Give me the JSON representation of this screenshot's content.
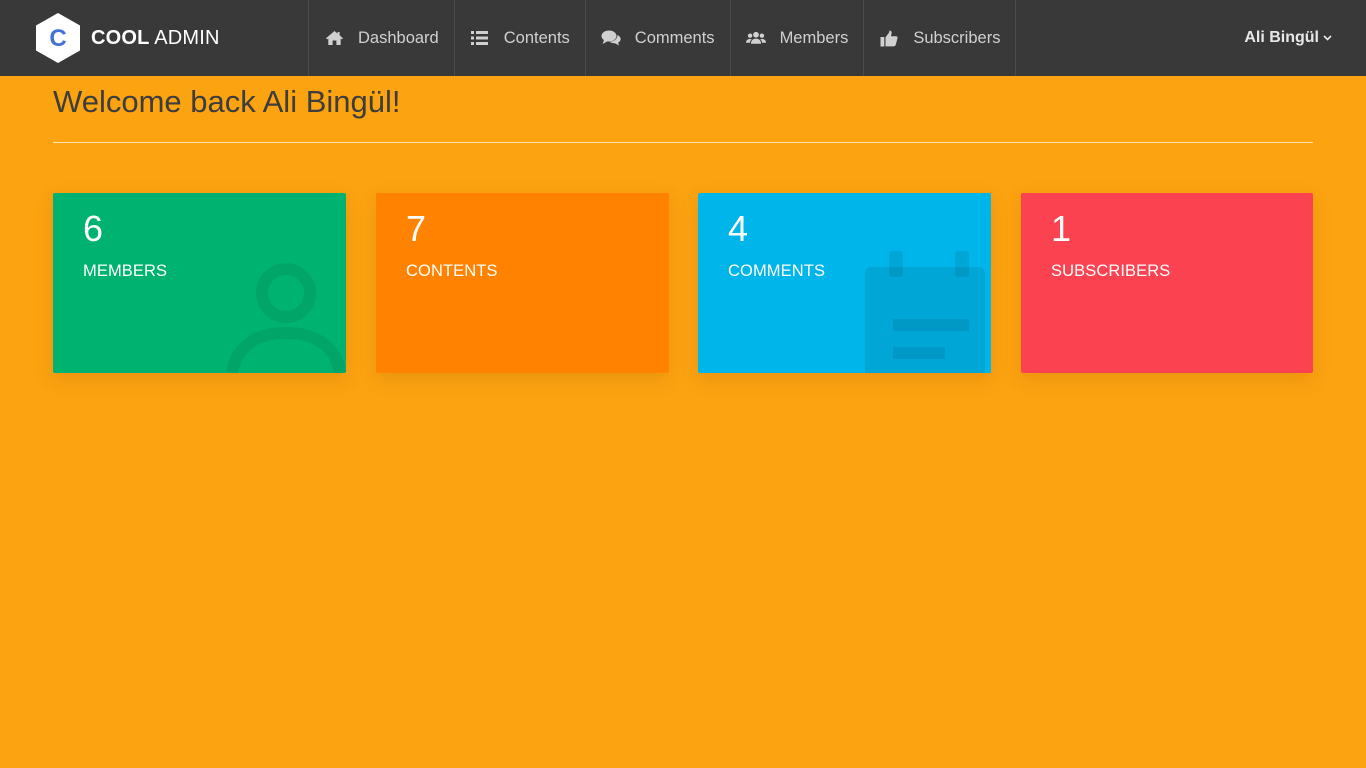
{
  "brand": {
    "logo_letter": "C",
    "name_bold": "COOL",
    "name_light": "ADMIN"
  },
  "nav": {
    "items": [
      {
        "label": "Dashboard",
        "icon": "home-icon"
      },
      {
        "label": "Contents",
        "icon": "list-icon"
      },
      {
        "label": "Comments",
        "icon": "comments-icon"
      },
      {
        "label": "Members",
        "icon": "users-icon"
      },
      {
        "label": "Subscribers",
        "icon": "thumbs-up-icon"
      }
    ]
  },
  "user": {
    "name": "Ali Bingül",
    "caret_icon": "chevron-down-icon"
  },
  "page": {
    "title": "Welcome back Ali Bingül!"
  },
  "stats": [
    {
      "value": "6",
      "label": "MEMBERS",
      "color": "#00b26f",
      "bg_icon": "user-icon"
    },
    {
      "value": "7",
      "label": "CONTENTS",
      "color": "#ff8300",
      "bg_icon": ""
    },
    {
      "value": "4",
      "label": "COMMENTS",
      "color": "#00b5e9",
      "bg_icon": "calendar-icon"
    },
    {
      "value": "1",
      "label": "SUBSCRIBERS",
      "color": "#fa4251",
      "bg_icon": ""
    }
  ],
  "colors": {
    "background": "#fca311",
    "topbar": "#393939",
    "title_text": "#3d3d3d",
    "logo_blue": "#4272d7"
  }
}
